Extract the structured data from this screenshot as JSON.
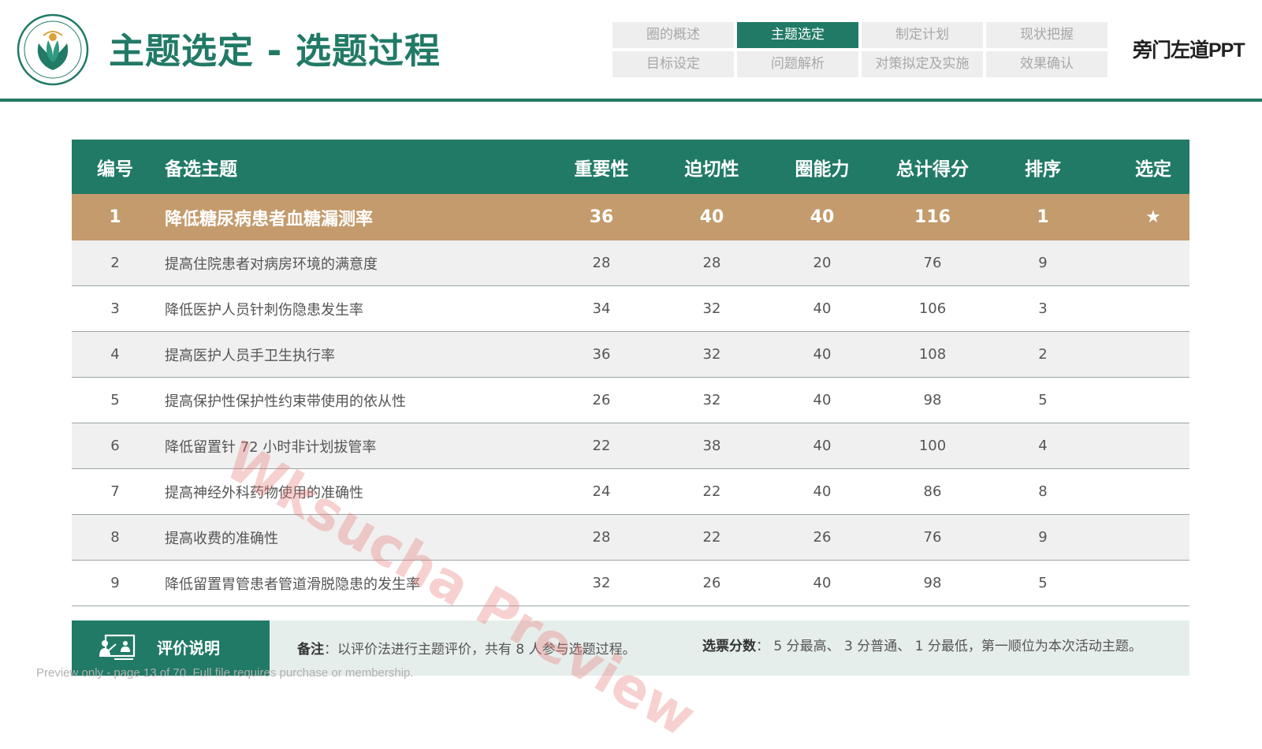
{
  "header": {
    "title": "主题选定 - 选题过程",
    "brand": "旁门左道PPT",
    "nav": [
      {
        "label": "圈的概述",
        "active": false
      },
      {
        "label": "主题选定",
        "active": true
      },
      {
        "label": "制定计划",
        "active": false
      },
      {
        "label": "现状把握",
        "active": false
      },
      {
        "label": "目标设定",
        "active": false
      },
      {
        "label": "问题解析",
        "active": false
      },
      {
        "label": "对策拟定及实施",
        "active": false
      },
      {
        "label": "效果确认",
        "active": false
      }
    ]
  },
  "table": {
    "headers": {
      "no": "编号",
      "topic": "备选主题",
      "importance": "重要性",
      "urgency": "迫切性",
      "capability": "圈能力",
      "total": "总计得分",
      "rank": "排序",
      "selected": "选定"
    },
    "selected_marker": "★",
    "rows": [
      {
        "no": "1",
        "topic": "降低糖尿病患者血糖漏测率",
        "importance": "36",
        "urgency": "40",
        "capability": "40",
        "total": "116",
        "rank": "1",
        "selected": "★"
      },
      {
        "no": "2",
        "topic": "提高住院患者对病房环境的满意度",
        "importance": "28",
        "urgency": "28",
        "capability": "20",
        "total": "76",
        "rank": "9",
        "selected": ""
      },
      {
        "no": "3",
        "topic": "降低医护人员针刺伤隐患发生率",
        "importance": "34",
        "urgency": "32",
        "capability": "40",
        "total": "106",
        "rank": "3",
        "selected": ""
      },
      {
        "no": "4",
        "topic": "提高医护人员手卫生执行率",
        "importance": "36",
        "urgency": "32",
        "capability": "40",
        "total": "108",
        "rank": "2",
        "selected": ""
      },
      {
        "no": "5",
        "topic": "提高保护性保护性约束带使用的依从性",
        "importance": "26",
        "urgency": "32",
        "capability": "40",
        "total": "98",
        "rank": "5",
        "selected": ""
      },
      {
        "no": "6",
        "topic": "降低留置针 72 小时非计划拔管率",
        "importance": "22",
        "urgency": "38",
        "capability": "40",
        "total": "100",
        "rank": "4",
        "selected": ""
      },
      {
        "no": "7",
        "topic": "提高神经外科药物使用的准确性",
        "importance": "24",
        "urgency": "22",
        "capability": "40",
        "total": "86",
        "rank": "8",
        "selected": ""
      },
      {
        "no": "8",
        "topic": "提高收费的准确性",
        "importance": "28",
        "urgency": "22",
        "capability": "26",
        "total": "76",
        "rank": "9",
        "selected": ""
      },
      {
        "no": "9",
        "topic": "降低留置胃管患者管道滑脱隐患的发生率",
        "importance": "32",
        "urgency": "26",
        "capability": "40",
        "total": "98",
        "rank": "5",
        "selected": ""
      }
    ]
  },
  "footer": {
    "label": "评价说明",
    "note1_key": "备注",
    "note1_text": "：以评价法进行主题评价，共有 8 人参与选题过程。",
    "note2_key": "选票分数",
    "note2_text": "： 5 分最高、 3 分普通、 1 分最低，第一顺位为本次活动主题。"
  },
  "watermark": "Wksucha Preview",
  "preview_note": "Preview only - page 13 of 70. Full file requires purchase or membership.",
  "colors": {
    "primary": "#217a66",
    "highlight": "#c49b6c",
    "row_alt": "#f0f0f0",
    "footer_bg": "#e6eeec",
    "nav_inactive": "#eeeeee"
  }
}
